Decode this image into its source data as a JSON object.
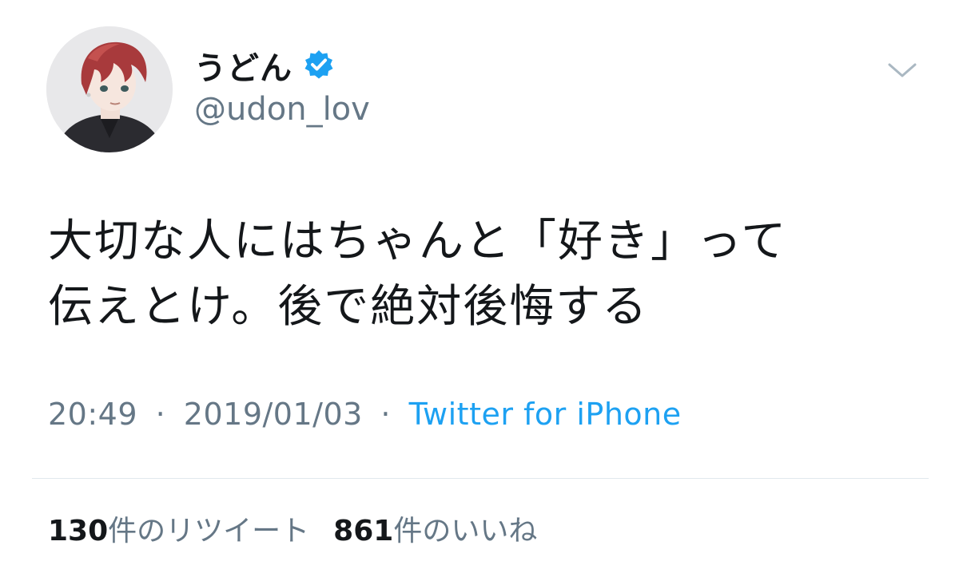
{
  "author": {
    "display_name": "うどん",
    "handle": "@udon_lov",
    "verified": true,
    "avatar": "anime-boy-red-hair-avatar"
  },
  "tweet": {
    "text_lines": [
      "大切な人にはちゃんと「好き」って",
      "伝えとけ。後で絶対後悔する"
    ],
    "time": "20:49",
    "date": "2019/01/03",
    "separator": "·",
    "source": "Twitter for iPhone"
  },
  "stats": {
    "retweets_count": "130",
    "retweets_label": "件のリツイート",
    "likes_count": "861",
    "likes_label": "件のいいね"
  },
  "icons": {
    "verified": "verified-badge-icon",
    "caret": "chevron-down-icon"
  },
  "colors": {
    "text": "#14171a",
    "secondary": "#657786",
    "link": "#1da1f2",
    "verified": "#1da1f2",
    "divider": "#e1e8ed"
  }
}
